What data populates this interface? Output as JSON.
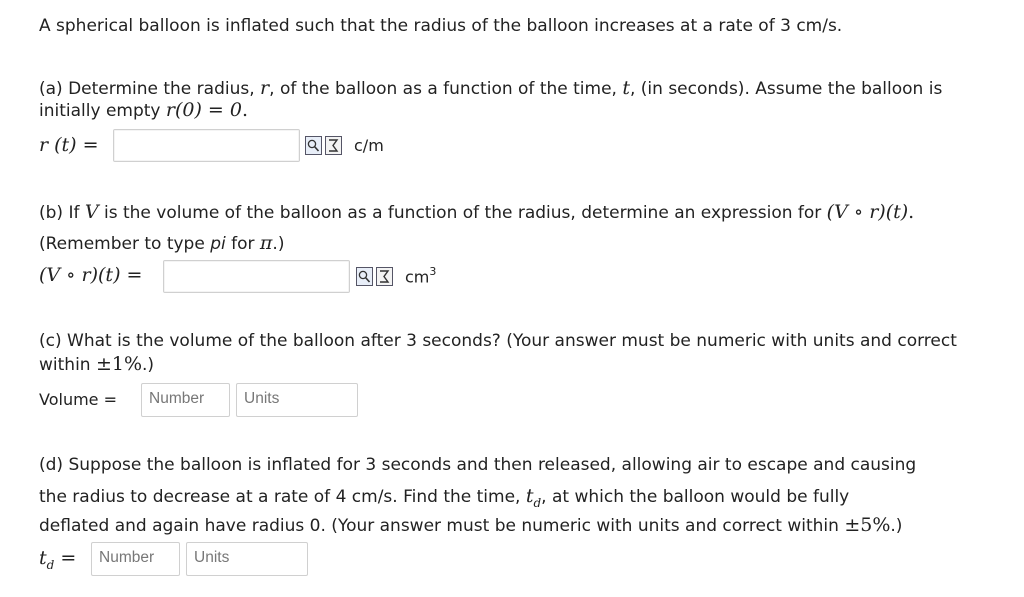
{
  "intro": "A spherical balloon is inflated such that the radius of the balloon increases at a rate of 3 cm/s.",
  "part_a": {
    "line1_pre": "(a) Determine the radius, ",
    "var_r": "r",
    "line1_mid1": ", of the balloon as a function of the time, ",
    "var_t": "t",
    "line1_mid2": ", (in seconds). Assume the balloon is",
    "line2_pre": "initially empty ",
    "cond": "r(0) = 0",
    "line2_post": ".",
    "answer_label": "r (t) =",
    "answer_value": "",
    "unit": "c/m"
  },
  "part_b": {
    "line1_pre": "(b) If ",
    "var_V": "V",
    "line1_mid": " is the volume of the balloon as a function of the radius, determine an expression for ",
    "expr": "(V ∘ r)(t)",
    "line1_post": ".",
    "line2_pre": "(Remember to type ",
    "pi_word": "pi",
    "line2_mid": " for ",
    "pi_symbol": "π",
    "line2_post": ".)",
    "answer_label": "(V ∘ r)(t) =",
    "answer_value": "",
    "unit_base": "cm",
    "unit_exp": "3"
  },
  "part_c": {
    "line1": "(c) What is the volume of the balloon after 3 seconds? (Your answer must be numeric with units and correct",
    "line2_pre": "within ",
    "tol": "±1%",
    "line2_post": ".)",
    "answer_label": "Volume =",
    "number_placeholder": "Number",
    "units_placeholder": "Units"
  },
  "part_d": {
    "line1": "(d) Suppose the balloon is inflated for 3 seconds and then released, allowing air to escape and causing",
    "line2_pre": "the radius to decrease at a rate of 4 cm/s. Find the time, ",
    "td_var": "t",
    "td_sub": "d",
    "line2_post": ", at which the balloon would be fully",
    "line3_pre": "deflated and again have radius 0. (Your answer must be numeric with units and correct within ",
    "tol": "±5%",
    "line3_post": ".)",
    "answer_label_var": "t",
    "answer_label_sub": "d",
    "answer_label_eq": " =",
    "number_placeholder": "Number",
    "units_placeholder": "Units"
  },
  "icons": [
    "preview-icon",
    "equation-editor-icon"
  ]
}
